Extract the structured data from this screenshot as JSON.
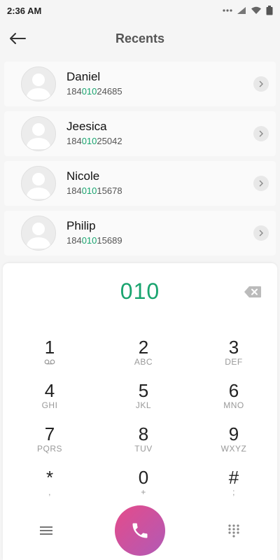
{
  "status_bar": {
    "time": "2:36 AM",
    "icons": [
      "more-dots-icon",
      "signal-icon",
      "wifi-icon",
      "battery-icon"
    ]
  },
  "header": {
    "title": "Recents",
    "back_icon": "arrow-left-icon"
  },
  "recents": [
    {
      "name": "Daniel",
      "number_prefix": "184",
      "number_match": "010",
      "number_suffix": "24685"
    },
    {
      "name": "Jeesica",
      "number_prefix": "184",
      "number_match": "010",
      "number_suffix": "25042"
    },
    {
      "name": "Nicole",
      "number_prefix": "184",
      "number_match": "010",
      "number_suffix": "15678"
    },
    {
      "name": "Philip",
      "number_prefix": "184",
      "number_match": "010",
      "number_suffix": "15689"
    }
  ],
  "dialer": {
    "entered_number": "010",
    "keys": [
      {
        "digit": "1",
        "letters": ""
      },
      {
        "digit": "2",
        "letters": "ABC"
      },
      {
        "digit": "3",
        "letters": "DEF"
      },
      {
        "digit": "4",
        "letters": "GHI"
      },
      {
        "digit": "5",
        "letters": "JKL"
      },
      {
        "digit": "6",
        "letters": "MNO"
      },
      {
        "digit": "7",
        "letters": "PQRS"
      },
      {
        "digit": "8",
        "letters": "TUV"
      },
      {
        "digit": "9",
        "letters": "WXYZ"
      },
      {
        "digit": "*",
        "letters": ","
      },
      {
        "digit": "0",
        "letters": "+"
      },
      {
        "digit": "#",
        "letters": ";"
      }
    ]
  },
  "colors": {
    "accent_green": "#1aa46f",
    "call_gradient_start": "#e54b8a",
    "call_gradient_end": "#b15ab6"
  }
}
